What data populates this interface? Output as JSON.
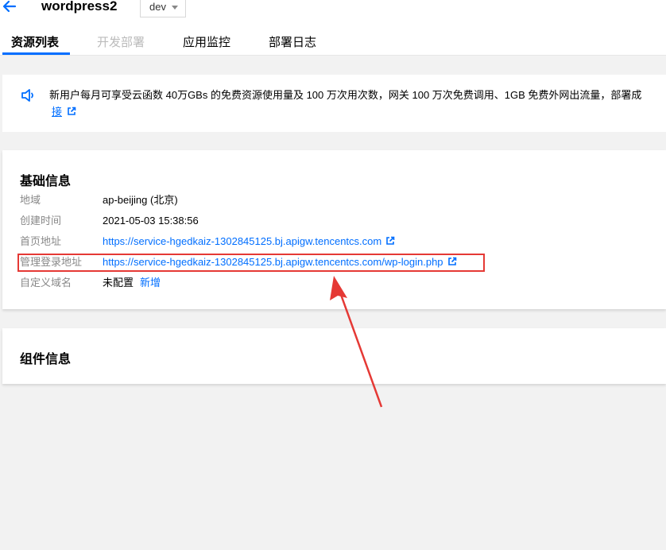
{
  "header": {
    "title": "wordpress2",
    "env_value": "dev"
  },
  "tabs": [
    {
      "label": "资源列表"
    },
    {
      "label": "开发部署"
    },
    {
      "label": "应用监控"
    },
    {
      "label": "部署日志"
    }
  ],
  "notice": {
    "text": "新用户每月可享受云函数 40万GBs 的免费资源使用量及 100 万次用次数，网关 100 万次免费调用、1GB 免费外网出流量，部署成",
    "link_text": "接"
  },
  "basic_info": {
    "title": "基础信息",
    "rows": [
      {
        "label": "地域",
        "value": "ap-beijing (北京)"
      },
      {
        "label": "创建时间",
        "value": "2021-05-03 15:38:56"
      },
      {
        "label": "首页地址",
        "value": "https://service-hgedkaiz-1302845125.bj.apigw.tencentcs.com"
      },
      {
        "label": "管理登录地址",
        "value": "https://service-hgedkaiz-1302845125.bj.apigw.tencentcs.com/wp-login.php"
      },
      {
        "label": "自定义域名",
        "value": "未配置",
        "action": "新增"
      }
    ]
  },
  "component_info": {
    "title": "组件信息"
  },
  "colors": {
    "accent": "#006eff",
    "highlight": "#e53935"
  }
}
